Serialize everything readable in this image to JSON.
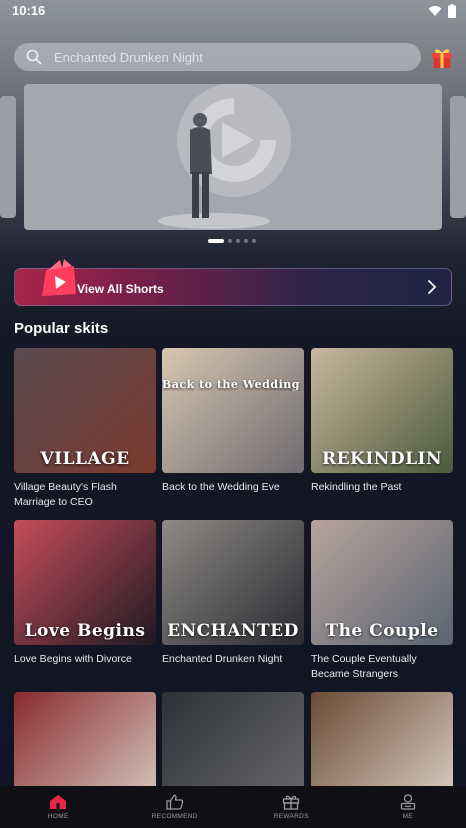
{
  "status": {
    "time": "10:16"
  },
  "search": {
    "placeholder": "Enchanted Drunken Night"
  },
  "banner": {
    "pages": 5,
    "active_page": 1
  },
  "view_all": {
    "label": "View All Shorts"
  },
  "section": {
    "title": "Popular skits"
  },
  "cards": [
    {
      "title": "Village Beauty's Flash Marriage to CEO",
      "poster_text": "VILLAGE",
      "color_a": "#5a4a50",
      "color_b": "#7a3a2e"
    },
    {
      "title": "Back to the Wedding Eve",
      "poster_text": "Back to the Wedding Eve",
      "color_a": "#d8c6b0",
      "color_b": "#6e6a6f"
    },
    {
      "title": "Rekindling the Past",
      "poster_text": "REKINDLIN",
      "color_a": "#c9b6a0",
      "color_b": "#4a5a3a"
    },
    {
      "title": "Love Begins with Divorce",
      "poster_text": "Love Begins",
      "color_a": "#c64d5a",
      "color_b": "#1f1a22"
    },
    {
      "title": "Enchanted Drunken Night",
      "poster_text": "ENCHANTED",
      "color_a": "#8e8a86",
      "color_b": "#2a2a30"
    },
    {
      "title": "The Couple Eventually Became Strangers",
      "poster_text": "The Couple",
      "color_a": "#b8a49a",
      "color_b": "#5a6474"
    },
    {
      "title": "",
      "poster_text": "",
      "color_a": "#8a2a2e",
      "color_b": "#d8d0c6"
    },
    {
      "title": "",
      "poster_text": "",
      "color_a": "#2e3236",
      "color_b": "#6a6a6c"
    },
    {
      "title": "",
      "poster_text": "",
      "color_a": "#6a4a36",
      "color_b": "#e0d6ca"
    }
  ],
  "tabs": [
    {
      "label": "HOME",
      "icon": "home-icon",
      "active": true
    },
    {
      "label": "RECOMMEND",
      "icon": "thumbs-up-icon",
      "active": false
    },
    {
      "label": "REWARDS",
      "icon": "gift-icon",
      "active": false
    },
    {
      "label": "ME",
      "icon": "user-icon",
      "active": false
    }
  ],
  "colors": {
    "accent": "#e8254a",
    "background": "#111423"
  }
}
